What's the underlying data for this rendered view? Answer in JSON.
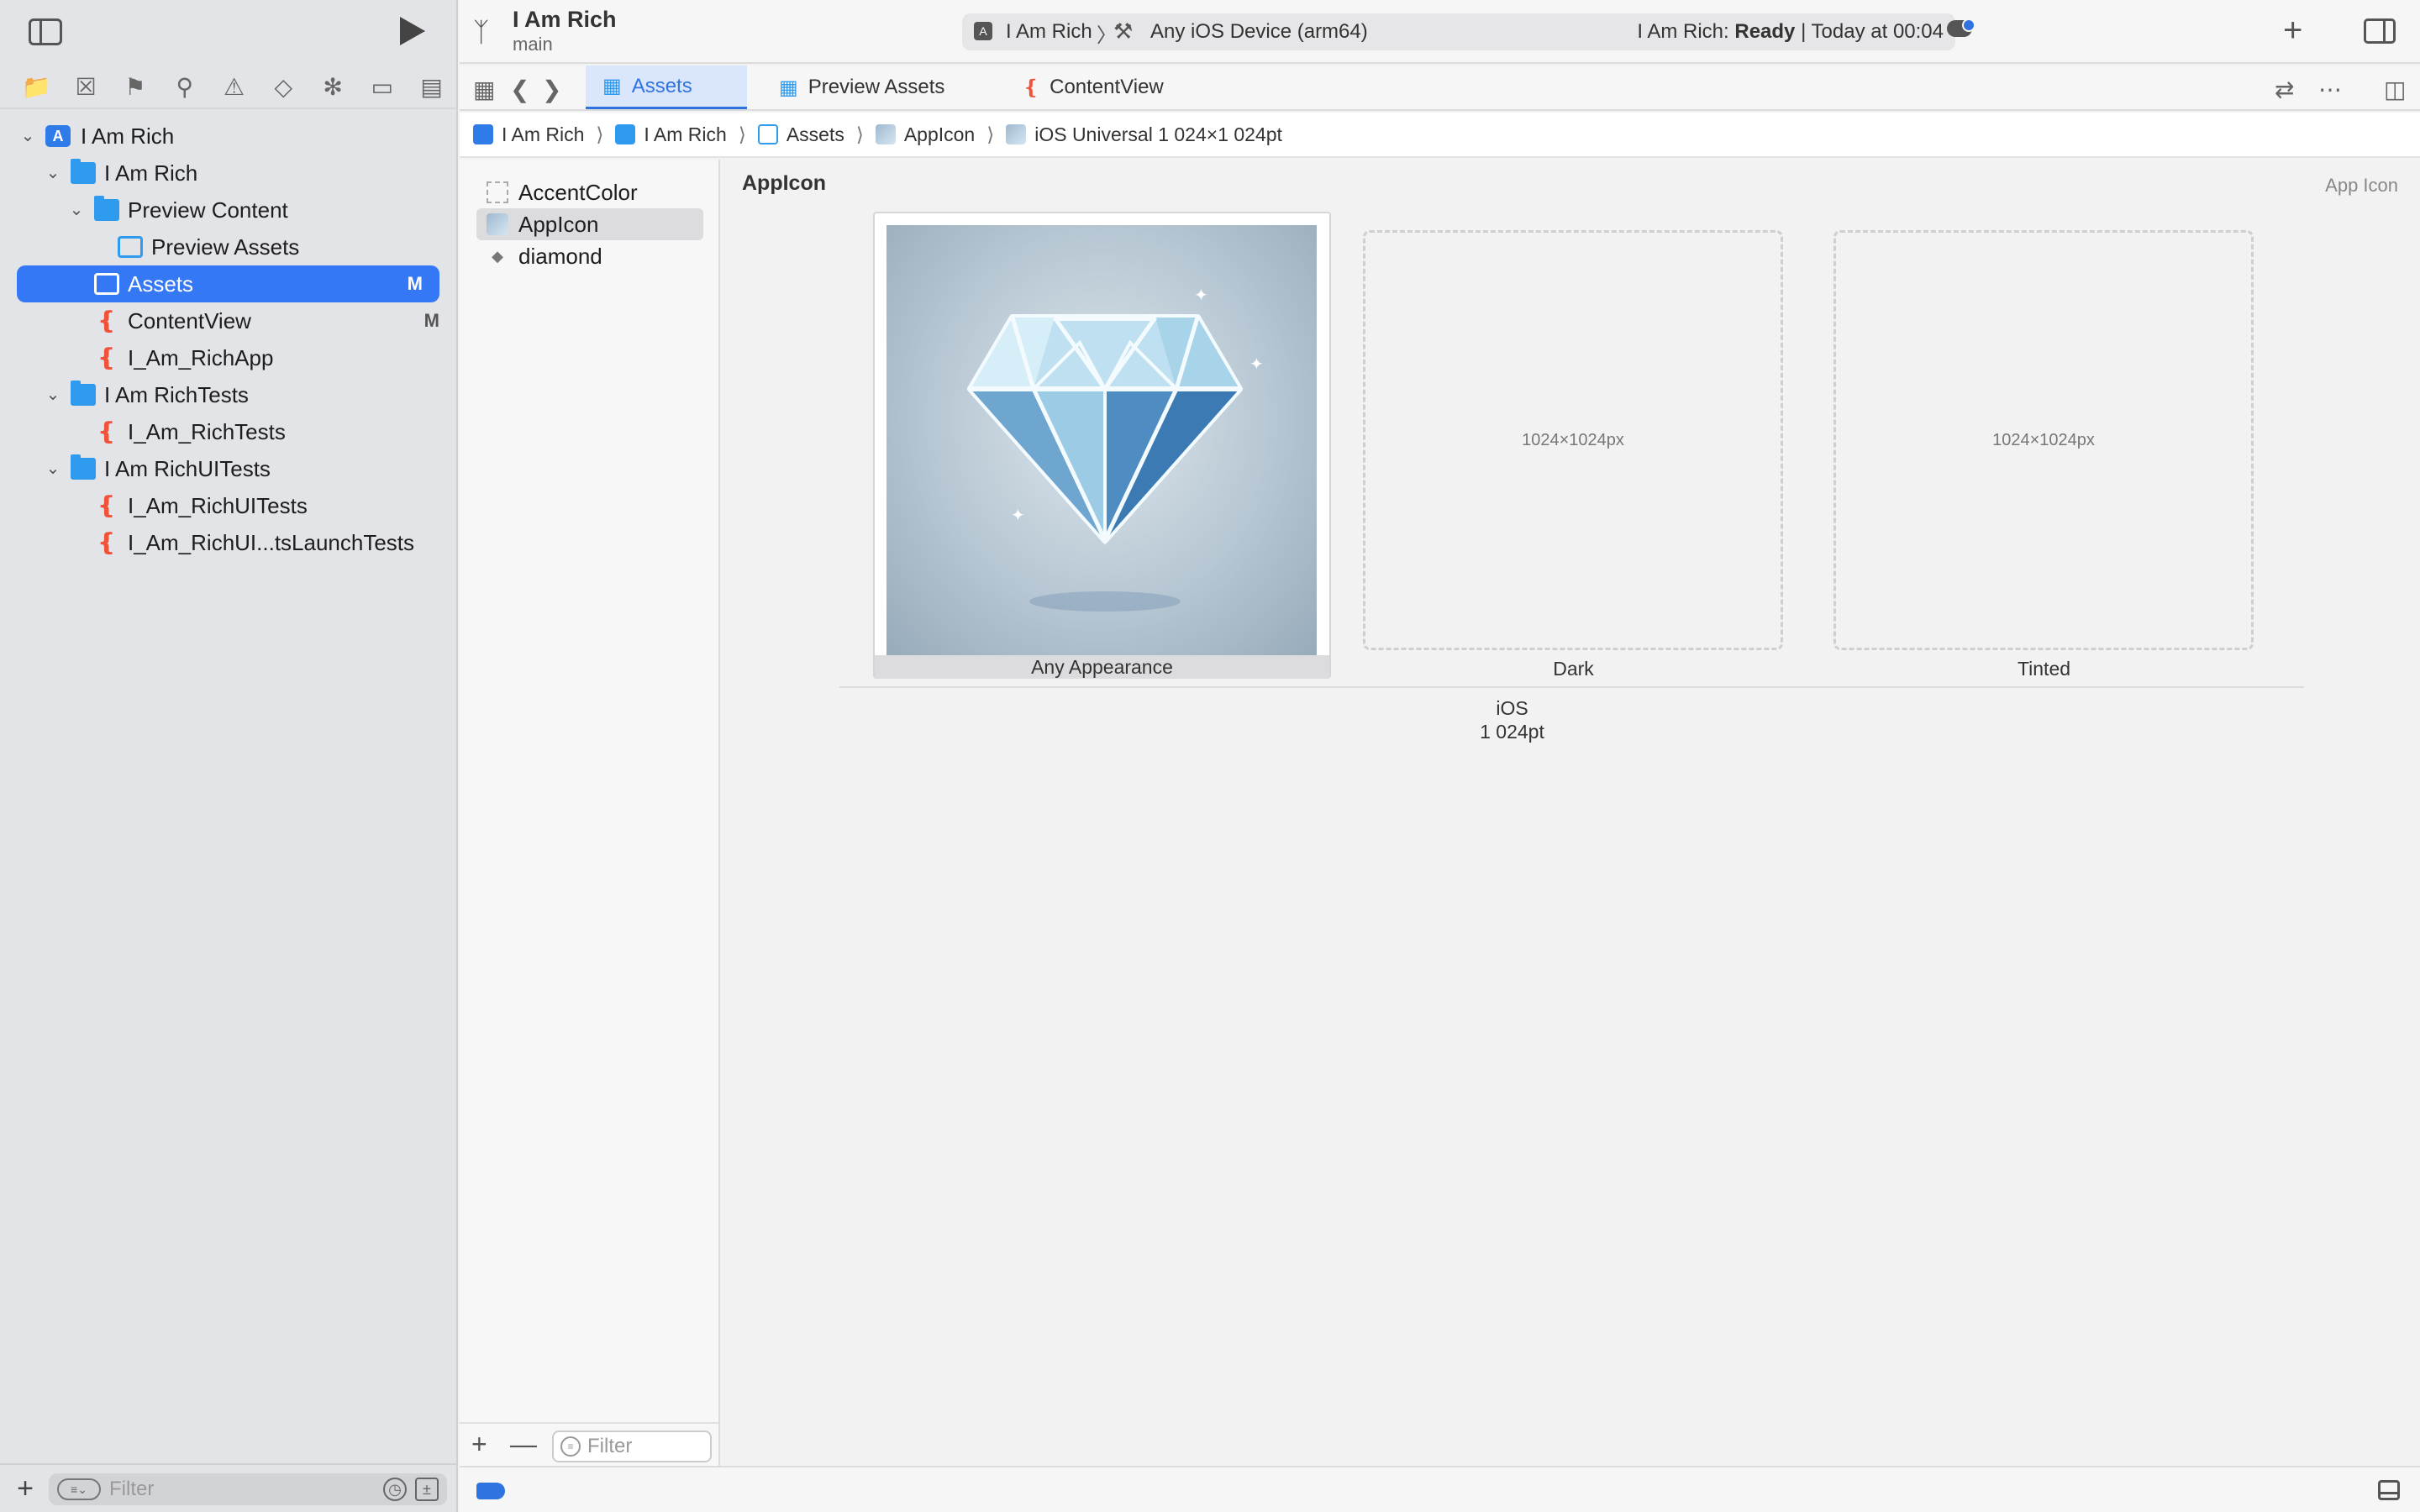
{
  "project": {
    "name": "I Am Rich",
    "branch": "main"
  },
  "activity": {
    "scheme": "I Am Rich",
    "separator": "〉",
    "device": "Any iOS Device (arm64)",
    "status_prefix": "I Am Rich: ",
    "status_state": "Ready",
    "status_time": " | Today at 00:04"
  },
  "navigator": {
    "icons": [
      "folder-icon",
      "source-control-icon",
      "bookmark-icon",
      "find-icon",
      "issue-icon",
      "test-icon",
      "debug-icon",
      "breakpoint-icon",
      "report-icon"
    ],
    "tree": [
      {
        "label": "I Am Rich",
        "type": "project",
        "level": 0,
        "disclosure": "open"
      },
      {
        "label": "I Am Rich",
        "type": "folder",
        "level": 1,
        "disclosure": "open"
      },
      {
        "label": "Preview Content",
        "type": "folder",
        "level": 2,
        "disclosure": "open"
      },
      {
        "label": "Preview Assets",
        "type": "assets",
        "level": 3
      },
      {
        "label": "Assets",
        "type": "assets",
        "level": 2,
        "badge": "M",
        "selected": true
      },
      {
        "label": "ContentView",
        "type": "swift",
        "level": 2,
        "badge": "M"
      },
      {
        "label": "I_Am_RichApp",
        "type": "swift",
        "level": 2
      },
      {
        "label": "I Am RichTests",
        "type": "folder",
        "level": 1,
        "disclosure": "open"
      },
      {
        "label": "I_Am_RichTests",
        "type": "swift",
        "level": 2
      },
      {
        "label": "I Am RichUITests",
        "type": "folder",
        "level": 1,
        "disclosure": "open"
      },
      {
        "label": "I_Am_RichUITests",
        "type": "swift",
        "level": 2
      },
      {
        "label": "I_Am_RichUI...tsLaunchTests",
        "type": "swift",
        "level": 2
      }
    ],
    "filter_placeholder": "Filter"
  },
  "tabs": [
    {
      "label": "Assets",
      "icon": "assets-icon",
      "active": true
    },
    {
      "label": "Preview Assets",
      "icon": "assets-icon",
      "active": false
    },
    {
      "label": "ContentView",
      "icon": "swift-icon",
      "active": false
    }
  ],
  "breadcrumbs": [
    "I Am Rich",
    "I Am Rich",
    "Assets",
    "AppIcon",
    "iOS Universal 1 024×1 024pt"
  ],
  "assets": {
    "items": [
      {
        "label": "AccentColor",
        "icon": "color-set-icon"
      },
      {
        "label": "AppIcon",
        "icon": "app-icon-set-icon",
        "selected": true
      },
      {
        "label": "diamond",
        "icon": "image-set-icon"
      }
    ],
    "filter_placeholder": "Filter"
  },
  "editor": {
    "title": "AppIcon",
    "type_label": "App Icon",
    "slots": [
      {
        "label": "Any Appearance",
        "filled": true,
        "placeholder": ""
      },
      {
        "label": "Dark",
        "filled": false,
        "placeholder": "1024×1024px"
      },
      {
        "label": "Tinted",
        "filled": false,
        "placeholder": "1024×1024px"
      }
    ],
    "group_platform": "iOS",
    "group_size": "1 024pt"
  },
  "colors": {
    "accent": "#3478f6",
    "swift": "#f0533a",
    "folder": "#2e9bee"
  }
}
